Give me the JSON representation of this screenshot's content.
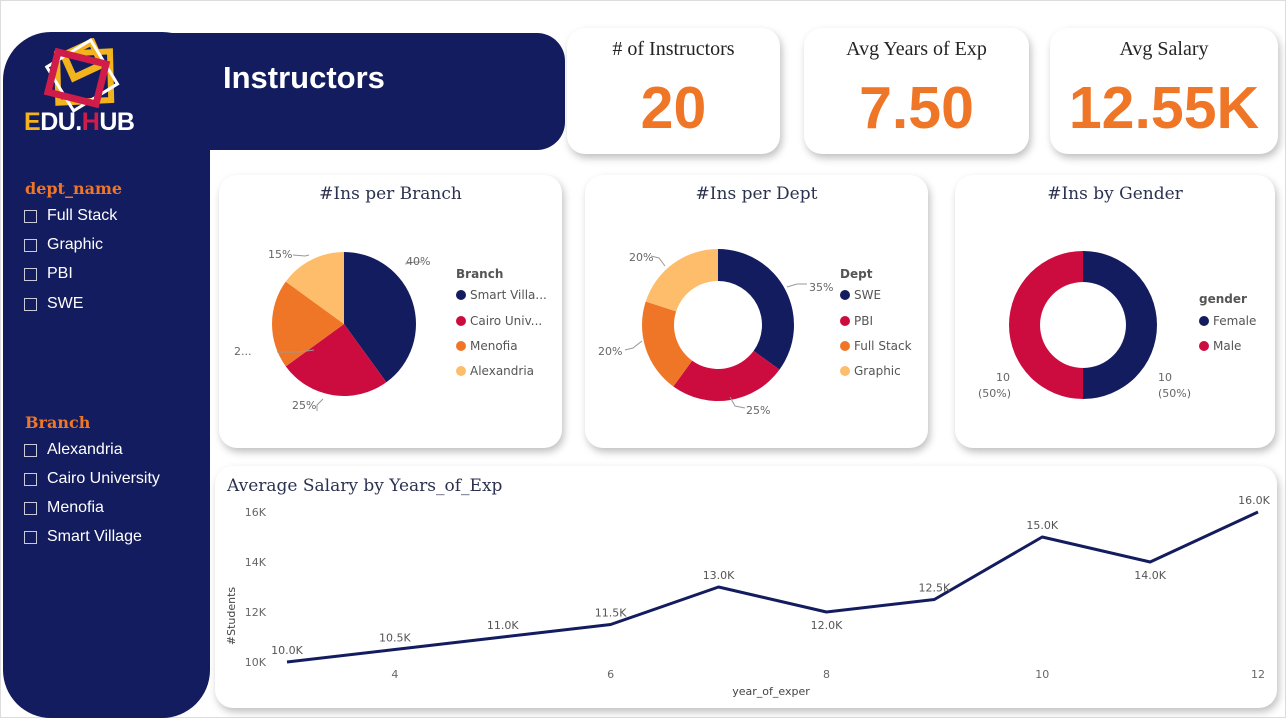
{
  "brand": {
    "logo_e": "E",
    "logo_du": "DU",
    "logo_dot": ".",
    "logo_h": "H",
    "logo_ub": "UB"
  },
  "header": {
    "title": "Instructors"
  },
  "colors": {
    "navy": "#131c5e",
    "orange": "#f07627",
    "crimson": "#cc0c3f",
    "light_orange": "#fdbd6a",
    "gold": "#f2b31c"
  },
  "filters": {
    "dept": {
      "title": "dept_name",
      "options": [
        "Full Stack",
        "Graphic",
        "PBI",
        "SWE"
      ]
    },
    "branch": {
      "title": "Branch",
      "options": [
        "Alexandria",
        "Cairo University",
        "Menofia",
        "Smart Village"
      ]
    }
  },
  "kpis": [
    {
      "title": "# of Instructors",
      "value": "20"
    },
    {
      "title": "Avg Years of Exp",
      "value": "7.50"
    },
    {
      "title": "Avg Salary",
      "value": "12.55K"
    }
  ],
  "charts": {
    "branch": {
      "title": "#Ins per Branch",
      "legend_title": "Branch",
      "legend": [
        "Smart Villa...",
        "Cairo Univ...",
        "Menofia",
        "Alexandria"
      ],
      "labels": [
        "40%",
        "25%",
        "2...",
        "15%"
      ]
    },
    "dept": {
      "title": "#Ins per Dept",
      "legend_title": "Dept",
      "legend": [
        "SWE",
        "PBI",
        "Full Stack",
        "Graphic"
      ],
      "labels": [
        "35%",
        "25%",
        "20%",
        "20%"
      ]
    },
    "gender": {
      "title": "#Ins by Gender",
      "legend_title": "gender",
      "legend": [
        "Female",
        "Male"
      ],
      "label_right_value": "10",
      "label_right_pct": "(50%)",
      "label_left_value": "10",
      "label_left_pct": "(50%)"
    },
    "salary": {
      "title": "Average Salary by Years_of_Exp",
      "xlabel": "year_of_exper",
      "ylabel": "#Students",
      "x_ticks": [
        "4",
        "6",
        "8",
        "10",
        "12"
      ],
      "y_ticks": [
        "10K",
        "12K",
        "14K",
        "16K"
      ],
      "point_labels": [
        "10.0K",
        "10.5K",
        "11.0K",
        "11.5K",
        "13.0K",
        "12.0K",
        "12.5K",
        "15.0K",
        "14.0K",
        "16.0K"
      ]
    }
  },
  "chart_data": [
    {
      "type": "pie",
      "title": "#Ins per Branch",
      "categories": [
        "Smart Village",
        "Cairo University",
        "Menofia",
        "Alexandria"
      ],
      "values": [
        40,
        25,
        20,
        15
      ],
      "colors": [
        "#131c5e",
        "#cc0c3f",
        "#f07627",
        "#fdbd6a"
      ],
      "legend": "right"
    },
    {
      "type": "pie",
      "donut": true,
      "title": "#Ins per Dept",
      "categories": [
        "SWE",
        "PBI",
        "Full Stack",
        "Graphic"
      ],
      "values": [
        35,
        25,
        20,
        20
      ],
      "colors": [
        "#131c5e",
        "#cc0c3f",
        "#f07627",
        "#fdbd6a"
      ],
      "legend": "right"
    },
    {
      "type": "pie",
      "donut": true,
      "title": "#Ins by Gender",
      "categories": [
        "Female",
        "Male"
      ],
      "values": [
        10,
        10
      ],
      "colors": [
        "#131c5e",
        "#cc0c3f"
      ],
      "legend": "right"
    },
    {
      "type": "line",
      "title": "Average Salary by Years_of_Exp",
      "xlabel": "year_of_exper",
      "ylabel": "#Students",
      "x": [
        3,
        4,
        5,
        6,
        7,
        8,
        9,
        10,
        11,
        12
      ],
      "values": [
        10000,
        10500,
        11000,
        11500,
        13000,
        12000,
        12500,
        15000,
        14000,
        16000
      ],
      "xlim": [
        3,
        12
      ],
      "ylim": [
        10000,
        16000
      ],
      "color": "#131c5e",
      "grid": false
    }
  ]
}
